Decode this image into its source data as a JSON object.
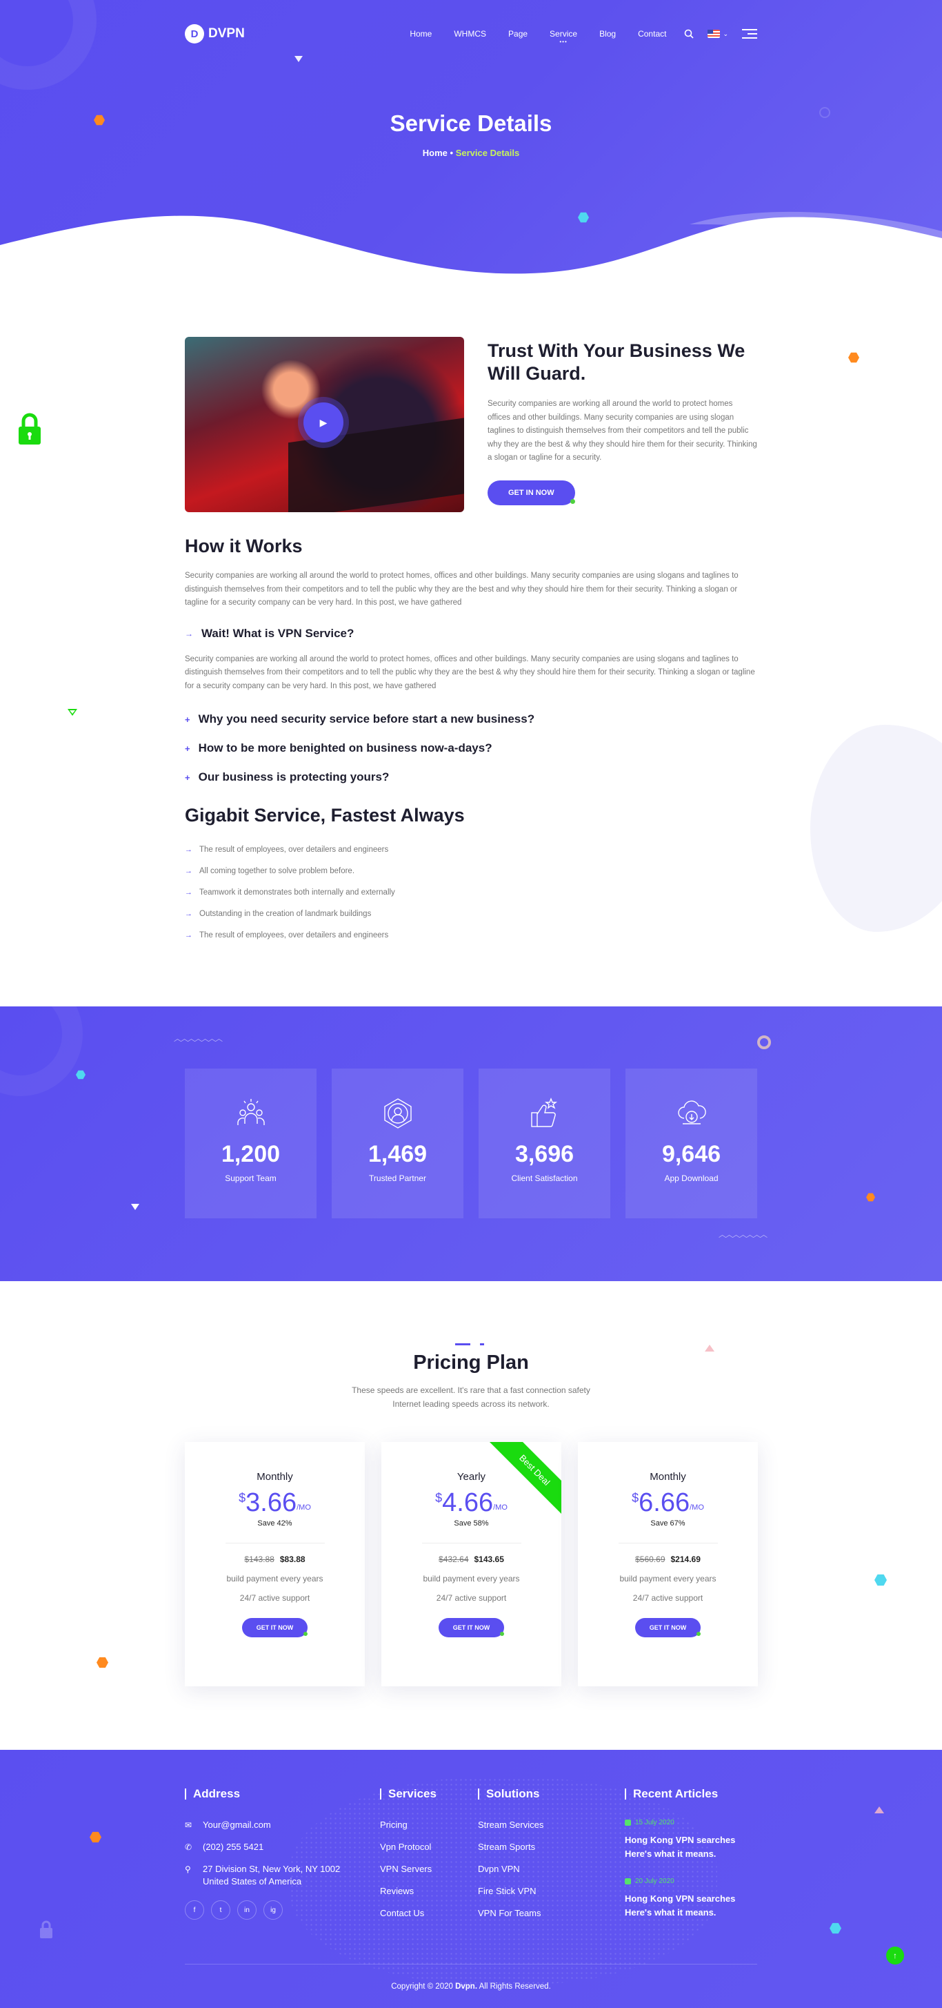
{
  "header": {
    "logo": "DVPN",
    "logo_mark": "D",
    "menu": [
      "Home",
      "WHMCS",
      "Page",
      "Service",
      "Blog",
      "Contact"
    ],
    "active_menu": "Service"
  },
  "hero": {
    "title": "Service Details",
    "breadcrumb_home": "Home",
    "breadcrumb_sep": "•",
    "breadcrumb_current": "Service Details"
  },
  "intro": {
    "title": "Trust With Your Business We Will Guard.",
    "text": "Security companies are working all around the world to protect homes offices and other buildings. Many security companies are using slogan taglines to distinguish themselves from their competitors and tell the public why they are the best & why they should hire them for their security. Thinking a slogan or tagline for a security.",
    "button": "GET IN NOW"
  },
  "how": {
    "title": "How it Works",
    "text1": "Security companies are working all around the world to protect homes, offices and other buildings. Many security companies are using slogans and taglines to distinguish themselves from their competitors and to tell the public why they are the best and why they should hire them for their security. Thinking a slogan or tagline for a security company can be very hard. In this post, we have gathered",
    "q1": "Wait! What is VPN Service?",
    "text2": "Security companies are working all around the world to protect homes, offices and other buildings. Many security companies are using slogans and taglines to distinguish themselves from their competitors and to tell the public why they are the best & why they should hire them for their security. Thinking a slogan or tagline for a security company can be very hard. In this post, we have gathered",
    "q2": "Why you need security service before start a new business?",
    "q3": "How to be more benighted on business now-a-days?",
    "q4": "Our business is protecting yours?"
  },
  "giga": {
    "title": "Gigabit Service, Fastest Always",
    "items": [
      "The result of employees, over detailers and engineers",
      "All coming together to solve problem before.",
      "Teamwork it demonstrates both internally and externally",
      "Outstanding in the creation of landmark buildings",
      "The result of employees, over detailers and engineers"
    ]
  },
  "counters": [
    {
      "num": "1,200",
      "label": "Support Team",
      "icon": "team-icon"
    },
    {
      "num": "1,469",
      "label": "Trusted Partner",
      "icon": "partner-network-icon"
    },
    {
      "num": "3,696",
      "label": "Client Satisfaction",
      "icon": "thumbs-up-icon"
    },
    {
      "num": "9,646",
      "label": "App Download",
      "icon": "cloud-download-icon"
    }
  ],
  "pricing": {
    "title": "Pricing Plan",
    "sub1": "These speeds are excellent. It's rare that a fast connection safety",
    "sub2": "Internet leading speeds across its network.",
    "ribbon": "Best Deal",
    "plans": [
      {
        "period": "Monthly",
        "currency": "$",
        "price": "3.66",
        "unit": "/MO",
        "save": "Save 42%",
        "old": "$143.88",
        "new": "$83.88",
        "f1": "build payment every years",
        "f2": "24/7 active support",
        "btn": "GET IT NOW"
      },
      {
        "period": "Yearly",
        "currency": "$",
        "price": "4.66",
        "unit": "/MO",
        "save": "Save 58%",
        "old": "$432.64",
        "new": "$143.65",
        "f1": "build payment every years",
        "f2": "24/7 active support",
        "btn": "GET IT NOW"
      },
      {
        "period": "Monthly",
        "currency": "$",
        "price": "6.66",
        "unit": "/MO",
        "save": "Save 67%",
        "old": "$560.69",
        "new": "$214.69",
        "f1": "build payment every years",
        "f2": "24/7 active support",
        "btn": "GET IT NOW"
      }
    ]
  },
  "footer": {
    "address_title": "Address",
    "email": "Your@gmail.com",
    "phone": "(202) 255 5421",
    "addr1": "27 Division St, New York, NY 1002",
    "addr2": "United States of America",
    "social": [
      "f",
      "t",
      "in",
      "ig"
    ],
    "services_title": "Services",
    "services": [
      "Pricing",
      "Vpn Protocol",
      "VPN Servers",
      "Reviews",
      "Contact Us"
    ],
    "solutions_title": "Solutions",
    "solutions": [
      "Stream Services",
      "Stream Sports",
      "Dvpn VPN",
      "Fire Stick VPN",
      "VPN For Teams"
    ],
    "articles_title": "Recent Articles",
    "articles": [
      {
        "date": "15 July 2020",
        "title": "Hong Kong VPN searches Here's what it means."
      },
      {
        "date": "20 July 2020",
        "title": "Hong Kong VPN searches Here's what it means."
      }
    ],
    "copy_pre": "Copyright © 2020 ",
    "copy_brand": "Dvpn.",
    "copy_post": " All Rights Reserved."
  },
  "colors": {
    "primary": "#5a4ef0",
    "accent_green": "#1adb0f",
    "orange": "#ff8a1f",
    "cyan": "#4fd8ef"
  }
}
